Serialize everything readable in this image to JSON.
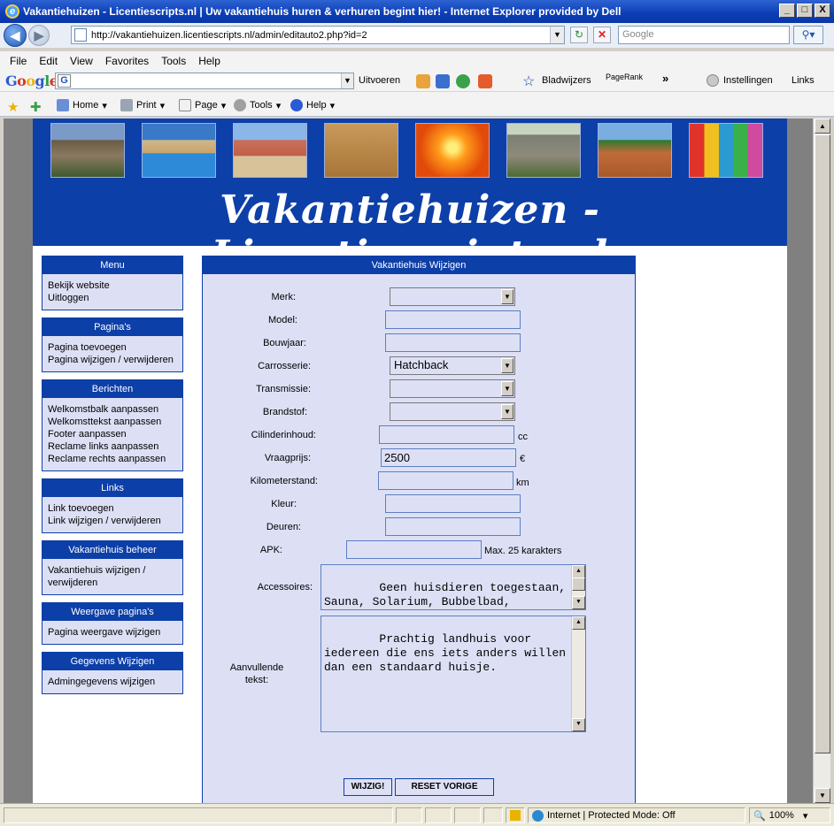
{
  "window": {
    "title": "Vakantiehuizen - Licentiescripts.nl | Uw vakantiehuis huren & verhuren begint hier! - Internet Explorer provided by Dell",
    "minimize": "_",
    "maximize": "□",
    "close": "X"
  },
  "address": {
    "url": "http://vakantiehuizen.licentiescripts.nl/admin/editauto2.php?id=2",
    "search_placeholder": "Google"
  },
  "menubar": [
    "File",
    "Edit",
    "View",
    "Favorites",
    "Tools",
    "Help"
  ],
  "google_toolbar": {
    "logo": "Google",
    "search_button": "Uitvoeren",
    "bookmarks": "Bladwijzers",
    "pagerank": "PageRank",
    "more": "»",
    "settings": "Instellingen",
    "links": "Links"
  },
  "command_bar": {
    "home": "Home",
    "print": "Print",
    "page": "Page",
    "tools": "Tools",
    "help": "Help"
  },
  "site": {
    "title": "Vakantiehuizen - Licentiescripts.nl"
  },
  "sidebar": [
    {
      "header": "Menu",
      "links": [
        "Bekijk website",
        "Uitloggen"
      ]
    },
    {
      "header": "Pagina's",
      "links": [
        "Pagina toevoegen",
        "Pagina wijzigen / verwijderen"
      ]
    },
    {
      "header": "Berichten",
      "links": [
        "Welkomstbalk aanpassen",
        "Welkomsttekst aanpassen",
        "Footer aanpassen",
        "Reclame links aanpassen",
        "Reclame rechts aanpassen"
      ]
    },
    {
      "header": "Links",
      "links": [
        "Link toevoegen",
        "Link wijzigen / verwijderen"
      ]
    },
    {
      "header": "Vakantiehuis beheer",
      "links": [
        "Vakantiehuis wijzigen /",
        "verwijderen"
      ]
    },
    {
      "header": "Weergave pagina's",
      "links": [
        "Pagina weergave wijzigen"
      ]
    },
    {
      "header": "Gegevens Wijzigen",
      "links": [
        "Admingegevens wijzigen"
      ]
    }
  ],
  "form": {
    "header": "Vakantiehuis Wijzigen",
    "fields": {
      "merk": {
        "label": "Merk:",
        "value": ""
      },
      "model": {
        "label": "Model:",
        "value": ""
      },
      "bouwjaar": {
        "label": "Bouwjaar:",
        "value": ""
      },
      "carrosserie": {
        "label": "Carrosserie:",
        "value": "Hatchback"
      },
      "transmissie": {
        "label": "Transmissie:",
        "value": ""
      },
      "brandstof": {
        "label": "Brandstof:",
        "value": ""
      },
      "cilinderinhoud": {
        "label": "Cilinderinhoud:",
        "value": "",
        "suffix": "cc"
      },
      "vraagprijs": {
        "label": "Vraagprijs:",
        "value": "2500",
        "suffix": "€"
      },
      "kilometerstand": {
        "label": "Kilometerstand:",
        "value": "",
        "suffix": "km"
      },
      "kleur": {
        "label": "Kleur:",
        "value": ""
      },
      "deuren": {
        "label": "Deuren:",
        "value": ""
      },
      "apk": {
        "label": "APK:",
        "value": "",
        "suffix": "Max. 25 karakters"
      },
      "accessoires": {
        "label": "Accessoires:",
        "value": "Geen huisdieren toegestaan, Sauna, Solarium, Bubbelbad, Zwembad, Rustig gelegen, Toegangkelijk"
      },
      "aanvullende": {
        "label_line1": "Aanvullende",
        "label_line2": "tekst:",
        "value": "Prachtig landhuis voor iedereen die ens iets anders willen dan een standaard huisje."
      }
    },
    "submit_label": "WIJZIG!",
    "reset_label": "RESET VORIGE"
  },
  "statusbar": {
    "zone": "Internet | Protected Mode: Off",
    "zoom": "100%"
  }
}
